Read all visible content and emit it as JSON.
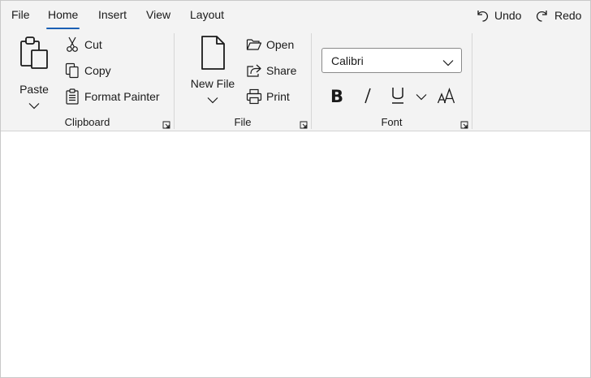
{
  "tabs": [
    {
      "label": "File"
    },
    {
      "label": "Home",
      "active": true
    },
    {
      "label": "Insert"
    },
    {
      "label": "View"
    },
    {
      "label": "Layout"
    }
  ],
  "quick_access": {
    "undo_label": "Undo",
    "redo_label": "Redo"
  },
  "clipboard": {
    "paste_label": "Paste",
    "cut_label": "Cut",
    "copy_label": "Copy",
    "format_painter_label": "Format Painter",
    "group_label": "Clipboard"
  },
  "file": {
    "new_file_label": "New File",
    "open_label": "Open",
    "share_label": "Share",
    "print_label": "Print",
    "group_label": "File"
  },
  "font": {
    "font_family_value": "Calibri",
    "group_label": "Font"
  },
  "colors": {
    "accent": "#1a5fb4",
    "ribbon_bg": "#f3f3f3",
    "canvas_bg": "#ffffff"
  },
  "icons": [
    "undo-icon",
    "redo-icon",
    "paste-icon",
    "cut-icon",
    "copy-icon",
    "format-painter-icon",
    "new-file-icon",
    "open-icon",
    "share-icon",
    "print-icon",
    "bold-icon",
    "italic-icon",
    "underline-icon",
    "font-size-icon",
    "dialog-launcher-icon",
    "chevron-down-icon"
  ]
}
